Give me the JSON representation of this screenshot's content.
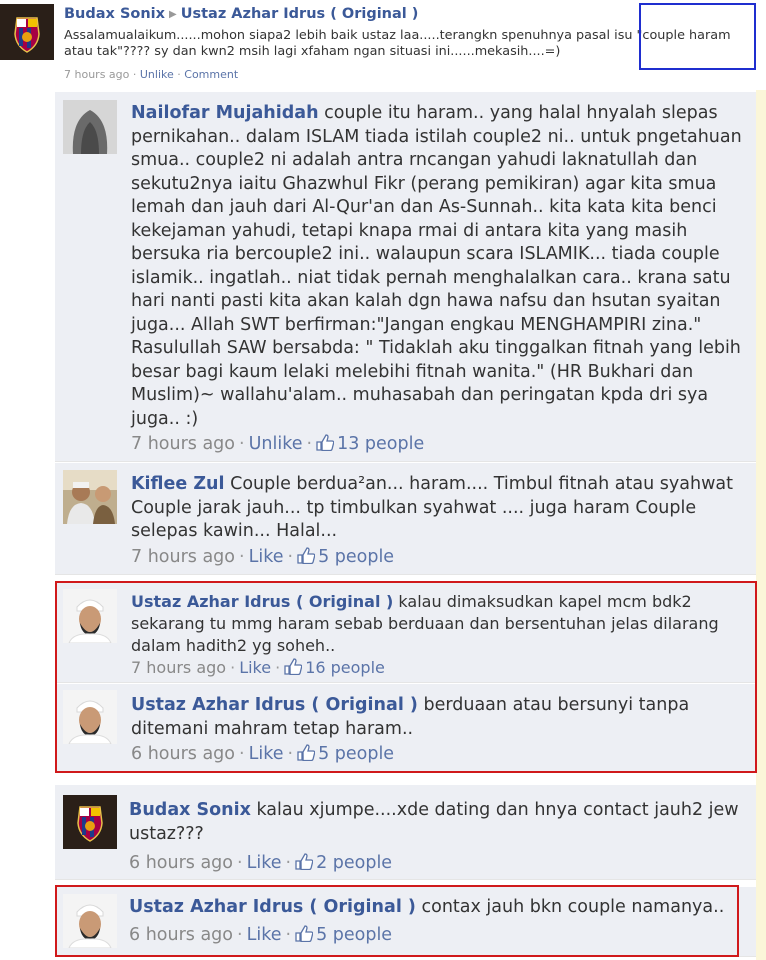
{
  "post": {
    "author": "Budax Sonix",
    "target": "Ustaz Azhar Idrus ( Original )",
    "text": "Assalamualaikum......mohon siapa2 lebih baik ustaz laa.....terangkn spenuhnya pasal isu \"couple haram atau tak\"???? sy dan kwn2 msih lagi xfaham ngan situasi ini......mekasih....=)",
    "time": "7 hours ago",
    "unlike": "Unlike",
    "comment": "Comment"
  },
  "comments": [
    {
      "author": "Nailofar Mujahidah",
      "text": "couple itu haram.. yang halal hnyalah slepas pernikahan.. dalam ISLAM tiada istilah couple2 ni.. untuk pngetahuan smua.. couple2 ni adalah antra rncangan yahudi laknatullah dan sekutu2nya iaitu Ghazwhul Fikr (perang pemikiran) agar kita smua lemah dan jauh dari Al-Qur'an dan As-Sunnah.. kita kata kita benci kekejaman yahudi, tetapi knapa rmai di antara kita yang masih bersuka ria bercouple2 ini.. walaupun scara ISLAMIK... tiada couple islamik.. ingatlah.. niat tidak pernah menghalalkan cara.. krana satu hari nanti pasti kita akan kalah dgn hawa nafsu dan hsutan syaitan juga... Allah SWT berfirman:\"Jangan engkau MENGHAMPIRI zina.\" Rasulullah SAW bersabda: \" Tidaklah aku tinggalkan fitnah yang lebih besar bagi kaum lelaki melebihi fitnah wanita.\" (HR Bukhari dan Muslim)~ wallahu'alam.. muhasabah dan peringatan kpda dri sya juga.. :)",
      "time": "7 hours ago",
      "action": "Unlike",
      "likes": "13 people"
    },
    {
      "author": "Kiflee Zul",
      "text": "Couple berdua²an... haram.... Timbul fitnah atau syahwat Couple jarak jauh... tp timbulkan syahwat .... juga haram Couple selepas kawin... Halal...",
      "time": "7 hours ago",
      "action": "Like",
      "likes": "5 people"
    },
    {
      "author": "Ustaz Azhar Idrus ( Original )",
      "text": "kalau dimaksudkan kapel mcm bdk2 sekarang tu mmg haram sebab berduaan dan bersentuhan jelas dilarang dalam hadith2 yg soheh..",
      "time": "7 hours ago",
      "action": "Like",
      "likes": "16 people"
    },
    {
      "author": "Ustaz Azhar Idrus ( Original )",
      "text": "berduaan atau bersunyi tanpa ditemani mahram tetap haram..",
      "time": "6 hours ago",
      "action": "Like",
      "likes": "5 people"
    },
    {
      "author": "Budax Sonix",
      "text": "kalau xjumpe....xde dating dan hnya contact jauh2 jew ustaz???",
      "time": "6 hours ago",
      "action": "Like",
      "likes": "2 people"
    },
    {
      "author": "Ustaz Azhar Idrus ( Original )",
      "text": "contax jauh bkn couple namanya..",
      "time": "6 hours ago",
      "action": "Like",
      "likes": "5 people"
    }
  ],
  "colors": {
    "link": "#3b5998",
    "comment_bg": "#edeff4",
    "highlight_red": "#d0191b",
    "highlight_blue": "#1f2ecf"
  },
  "icons": {
    "like": "thumbs-up-icon",
    "separator": "middle-dot"
  }
}
